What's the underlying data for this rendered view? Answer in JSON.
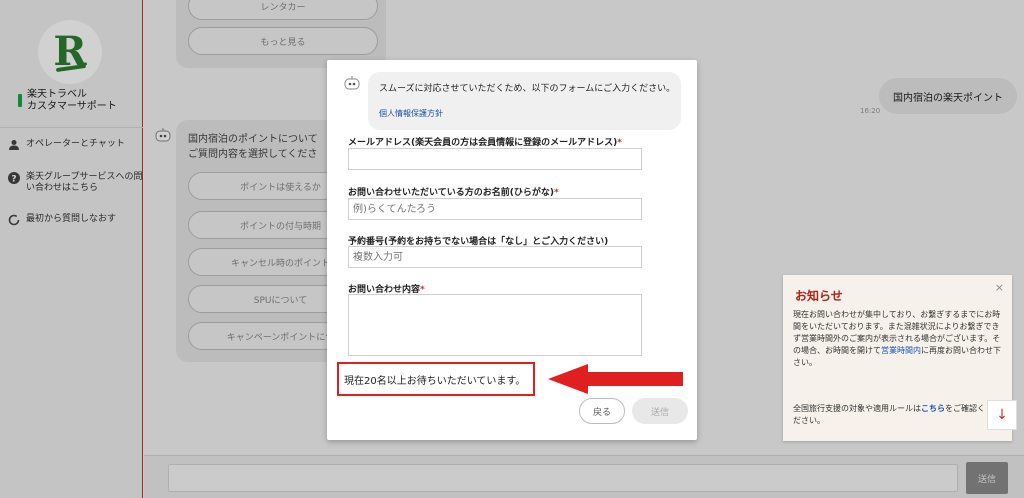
{
  "sidebar": {
    "brand_line1": "楽天トラベル",
    "brand_line2": "カスタマーサポート",
    "items": [
      {
        "label": "オペレーターとチャット",
        "icon": "person-icon"
      },
      {
        "label": "楽天グループサービスへの問い合わせはこちら",
        "icon": "question-circle-icon"
      },
      {
        "label": "最初から質問しなおす",
        "icon": "restart-icon"
      }
    ]
  },
  "chat": {
    "top_buttons": [
      "レンタカー",
      "もっと見る"
    ],
    "bot_message": "国内宿泊のポイントについて\nご質問内容を選択してくださ",
    "option_buttons": [
      "ポイントは使えるか",
      "ポイントの付与時期",
      "キャンセル時のポイント",
      "SPUについて",
      "キャンペーンポイントにつ"
    ],
    "user_message": "国内宿泊の楽天ポイント",
    "user_time": "16:20",
    "send_label": "送信"
  },
  "modal": {
    "message": "スムーズに対応させていただくため、以下のフォームにご入力ください。",
    "privacy_link": "個人情報保護方針",
    "fields": {
      "email": {
        "label": "メールアドレス(楽天会員の方は会員情報に登録のメールアドレス)",
        "required": "*",
        "placeholder": ""
      },
      "name": {
        "label": "お問い合わせいただいている方のお名前(ひらがな)",
        "required": "*",
        "placeholder": "例)らくてんたろう"
      },
      "booking": {
        "label": "予約番号(予約をお持ちでない場合は「なし」とご入力ください)",
        "placeholder": "複数入力可"
      },
      "inquiry": {
        "label": "お問い合わせ内容",
        "required": "*"
      }
    },
    "wait_status": "現在20名以上お待ちいただいています。",
    "back_label": "戻る",
    "send_label": "送信"
  },
  "notice": {
    "title": "お知らせ",
    "close": "×",
    "body_before": "現在お問い合わせが集中しており、お繋ぎするまでにお時間をいただいております。また混雑状況によりお繋ぎできず営業時間外のご案内が表示される場合がございます。その場合、お時間を開けて",
    "body_link": "営業時間内",
    "body_after": "に再度お問い合わせ下さい。",
    "foot_before": "全国旅行支援の対象や適用ルールは",
    "foot_link": "こちら",
    "foot_after": "をご確認ください。"
  },
  "colors": {
    "accent_red": "#e02020",
    "brand_green": "#2e7d32",
    "notice_title": "#b0241b"
  }
}
